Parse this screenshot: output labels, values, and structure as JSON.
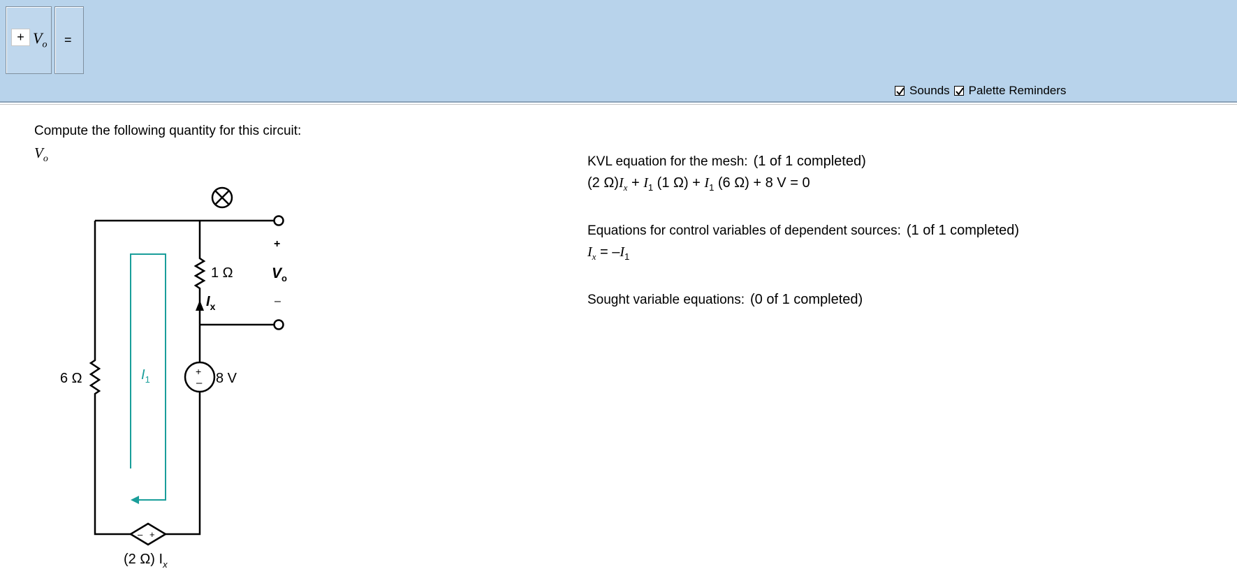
{
  "toolbar": {
    "sign": "+",
    "variable": "V",
    "variable_sub": "o",
    "equals": "=",
    "sounds_label": "Sounds",
    "sounds_checked": true,
    "palette_label": "Palette Reminders",
    "palette_checked": true
  },
  "problem": {
    "prompt": "Compute the following quantity for this circuit:",
    "quantity_var": "V",
    "quantity_sub": "o"
  },
  "circuit": {
    "r_top_label": "1 Ω",
    "r_left_label": "6 Ω",
    "source_label": "8 V",
    "output_plus": "+",
    "output_minus": "–",
    "output_label_var": "V",
    "output_label_sub": "o",
    "current_label_var": "I",
    "current_label_sub": "x",
    "mesh_label_var": "I",
    "mesh_label_sub": "1",
    "dep_source_label": "(2 Ω) I",
    "dep_source_sub": "x",
    "source_plus": "+",
    "source_minus": "–",
    "dep_plus": "+",
    "dep_minus": "–",
    "loop_color": "#1a9e9a"
  },
  "equations": {
    "kvl": {
      "title": "KVL equation for the mesh:",
      "status": "(1 of 1 completed)",
      "line": {
        "p1": "(2 Ω)",
        "v1": "I",
        "s1": "x",
        "p2": " + ",
        "v2": "I",
        "s2": "1",
        "p3": " (1 Ω) + ",
        "v3": "I",
        "s3": "1",
        "p4": " (6 Ω) + 8 V = 0"
      }
    },
    "control": {
      "title": "Equations for control variables of dependent sources:",
      "status": "(1 of 1 completed)",
      "line": {
        "v1": "I",
        "s1": "x",
        "p1": " = –",
        "v2": "I",
        "s2": "1"
      }
    },
    "sought": {
      "title": "Sought variable equations:",
      "status": "(0 of 1 completed)"
    }
  }
}
